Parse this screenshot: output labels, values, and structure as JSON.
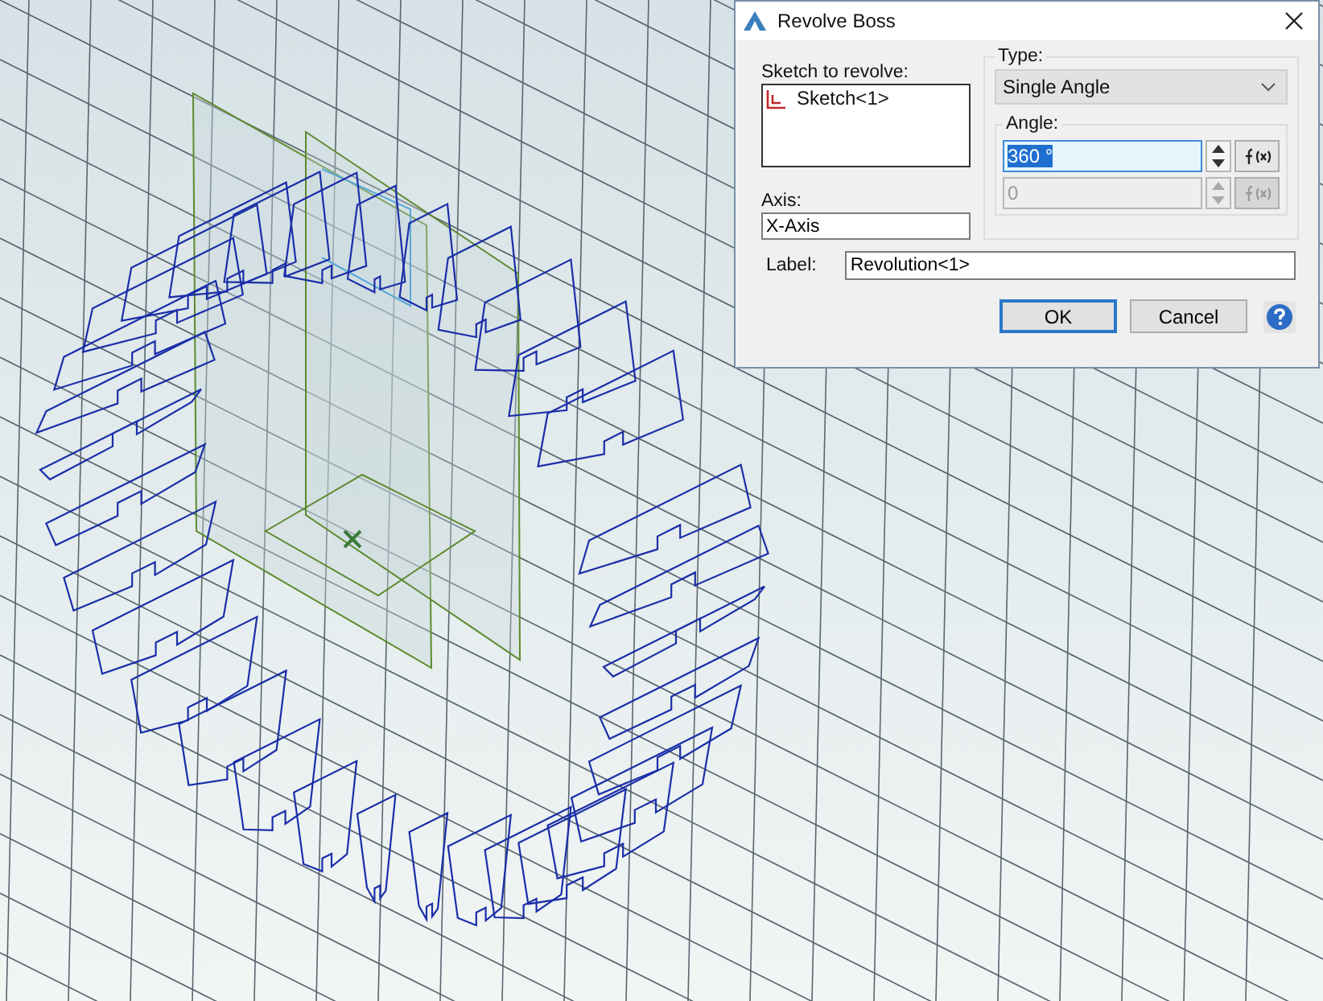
{
  "dialog": {
    "title": "Revolve Boss",
    "sketch_list": {
      "label": "Sketch to revolve:",
      "items": [
        {
          "text": "Sketch<1>"
        }
      ]
    },
    "axis": {
      "label": "Axis:",
      "value": "X-Axis"
    },
    "type": {
      "label": "Type:",
      "value": "Single Angle"
    },
    "angle": {
      "label": "Angle:",
      "fields": [
        {
          "value": "360 °",
          "focused": true,
          "disabled": false
        },
        {
          "value": "0",
          "focused": false,
          "disabled": true
        }
      ]
    },
    "label_field": {
      "label": "Label:",
      "value": "Revolution<1>"
    },
    "buttons": [
      {
        "label": "OK",
        "default": true
      },
      {
        "label": "Cancel",
        "default": false
      }
    ]
  }
}
